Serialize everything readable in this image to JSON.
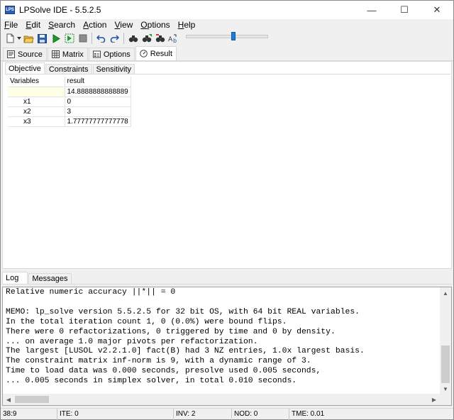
{
  "window": {
    "title": "LPSolve IDE - 5.5.2.5",
    "icon_label": "LPS",
    "controls": {
      "minimize": "—",
      "maximize": "☐",
      "close": "✕"
    }
  },
  "menu": {
    "items": [
      {
        "label": "File",
        "u": "F",
        "rest": "ile"
      },
      {
        "label": "Edit",
        "u": "E",
        "rest": "dit"
      },
      {
        "label": "Search",
        "u": "S",
        "rest": "earch"
      },
      {
        "label": "Action",
        "u": "A",
        "rest": "ction"
      },
      {
        "label": "View",
        "u": "V",
        "rest": "iew"
      },
      {
        "label": "Options",
        "u": "O",
        "rest": "ptions"
      },
      {
        "label": "Help",
        "u": "H",
        "rest": "elp"
      }
    ]
  },
  "toolbar": {
    "icons": [
      "new-file-icon",
      "open-folder-icon",
      "save-icon",
      "run-icon",
      "step-icon",
      "stop-icon",
      "undo-icon",
      "redo-icon",
      "find-icon",
      "find-next-icon",
      "replace-icon",
      "goto-icon"
    ],
    "slider_fraction": 0.58
  },
  "tabs": {
    "main": [
      "Source",
      "Matrix",
      "Options",
      "Result"
    ],
    "result_sub": [
      "Objective",
      "Constraints",
      "Sensitivity"
    ],
    "log": [
      "Log",
      "Messages"
    ]
  },
  "result": {
    "header": {
      "variables": "Variables",
      "result": "result"
    },
    "objective_value": "14.8888888888889",
    "rows": [
      {
        "name": "x1",
        "value": "0"
      },
      {
        "name": "x2",
        "value": "3"
      },
      {
        "name": "x3",
        "value": "1.77777777777778"
      }
    ]
  },
  "log": {
    "lines": [
      "Relative numeric accuracy ||*|| = 0",
      "",
      "MEMO: lp_solve version 5.5.2.5 for 32 bit OS, with 64 bit REAL variables.",
      "In the total iteration count 1, 0 (0.0%) were bound flips.",
      "There were 0 refactorizations, 0 triggered by time and 0 by density.",
      "... on average 1.0 major pivots per refactorization.",
      "The largest [LUSOL v2.2.1.0] fact(B) had 3 NZ entries, 1.0x largest basis.",
      "The constraint matrix inf-norm is 9, with a dynamic range of 3.",
      "Time to load data was 0.000 seconds, presolve used 0.005 seconds,",
      "... 0.005 seconds in simplex solver, in total 0.010 seconds."
    ]
  },
  "status": {
    "position": "38:9",
    "ite": "ITE: 0",
    "inv": "INV: 2",
    "nod": "NOD: 0",
    "tme": "TME: 0.01"
  }
}
